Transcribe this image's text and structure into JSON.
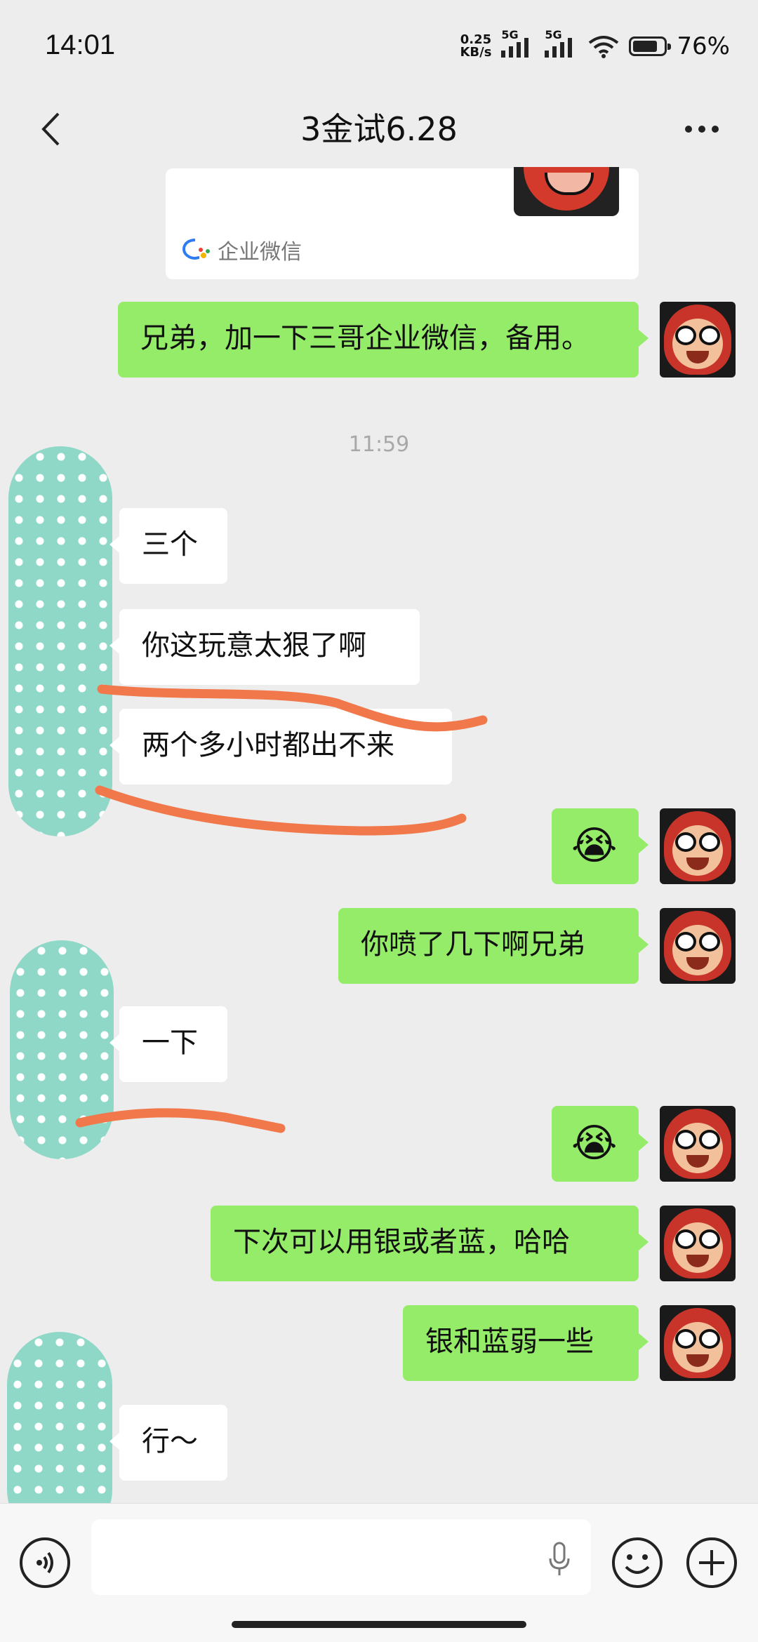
{
  "status_bar": {
    "time": "14:01",
    "net_speed_value": "0.25",
    "net_speed_unit": "KB/s",
    "sim1": "5G",
    "sim2": "5G",
    "battery": "76%"
  },
  "header": {
    "title": "3金试6.28"
  },
  "card": {
    "source_label": "企业微信"
  },
  "messages": {
    "m1": "兄弟，加一下三哥企业微信，备用。",
    "timestamp": "11:59",
    "m2": "三个",
    "m3": "你这玩意太狠了啊",
    "m4": "两个多小时都出不来",
    "m5": "😭",
    "m6": "你喷了几下啊兄弟",
    "m7": "一下",
    "m8": "😭",
    "m9": "下次可以用银或者蓝，哈哈",
    "m10": "银和蓝弱一些",
    "m11": "行～"
  },
  "colors": {
    "outgoing_bubble": "#95ec69",
    "incoming_bubble": "#ffffff",
    "background": "#ededed",
    "scribble": "#f0784a",
    "privacy_blob": "#8fd8c8"
  },
  "icons": {
    "back": "chevron-left-icon",
    "more": "more-dots-icon",
    "voice": "voice-icon",
    "mic": "mic-icon",
    "emoji": "emoji-icon",
    "plus": "plus-icon"
  }
}
